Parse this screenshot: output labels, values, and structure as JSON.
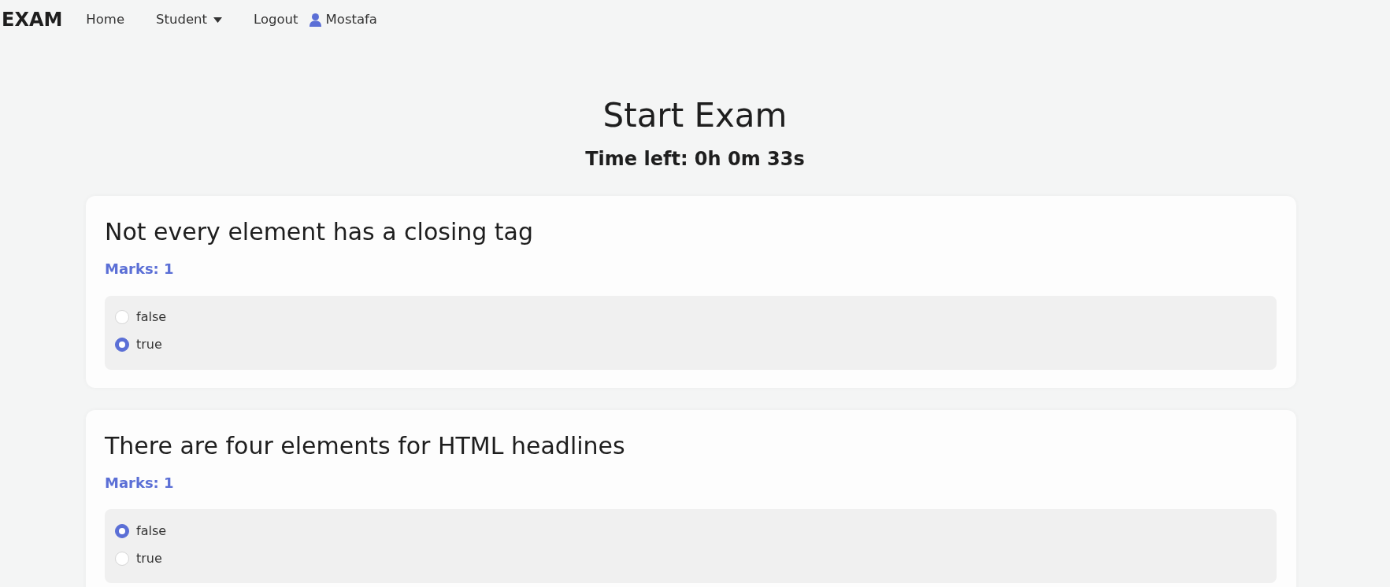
{
  "navbar": {
    "brand": "EXAM",
    "items": [
      {
        "label": "Home",
        "kind": "link"
      },
      {
        "label": "Student",
        "kind": "dropdown"
      },
      {
        "label": "Logout",
        "kind": "link"
      },
      {
        "label": "Mostafa",
        "kind": "user"
      }
    ]
  },
  "header": {
    "title": "Start Exam",
    "timer": "Time left: 0h 0m 33s"
  },
  "questions": [
    {
      "text": "Not every element has a closing tag",
      "marks": "Marks: 1",
      "options": [
        {
          "label": "false",
          "selected": false
        },
        {
          "label": "true",
          "selected": true
        }
      ]
    },
    {
      "text": "There are four elements for HTML headlines",
      "marks": "Marks: 1",
      "options": [
        {
          "label": "false",
          "selected": true
        },
        {
          "label": "true",
          "selected": false
        }
      ]
    }
  ]
}
